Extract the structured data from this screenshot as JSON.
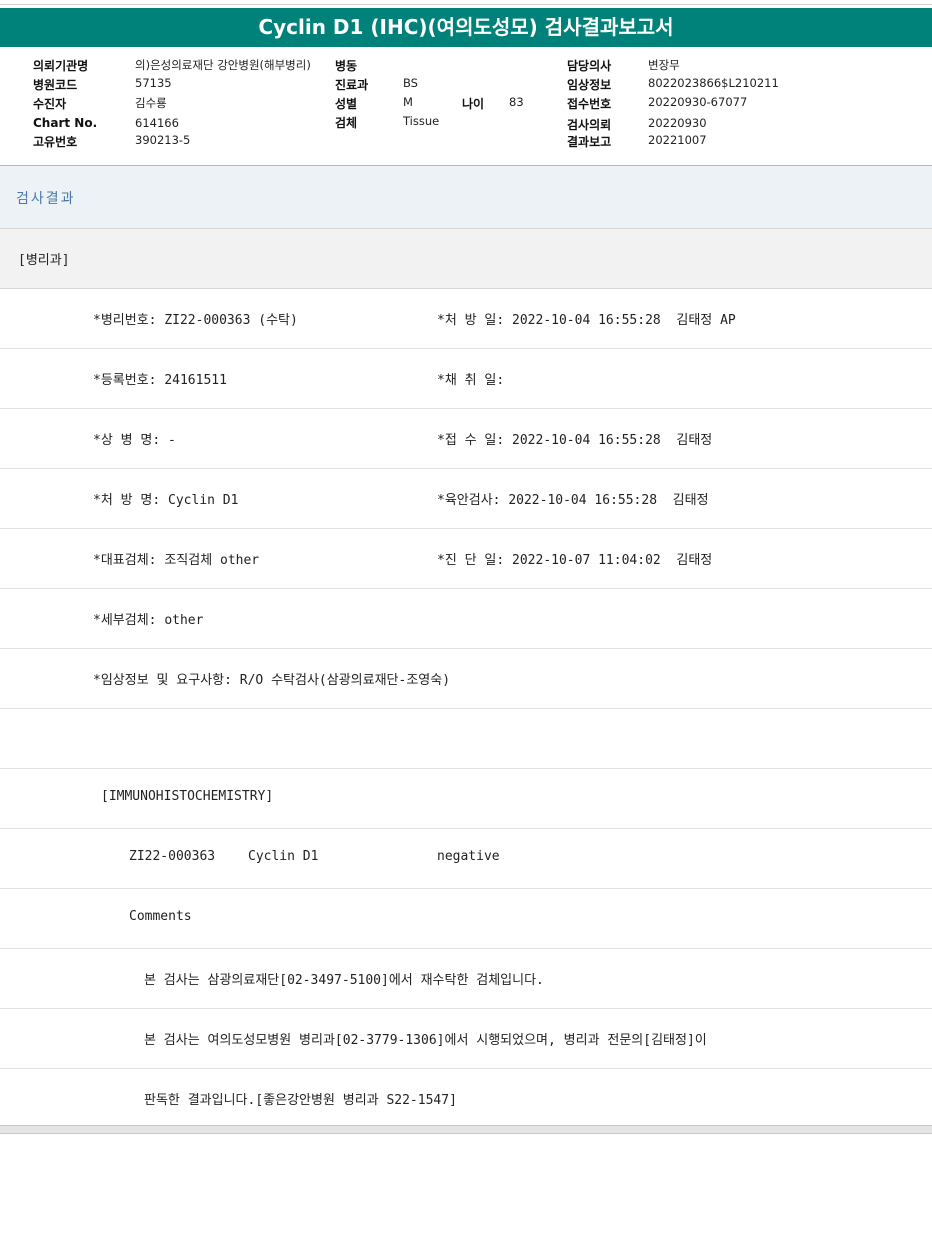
{
  "report": {
    "title": "Cyclin D1 (IHC)(여의도성모) 검사결과보고서"
  },
  "meta": {
    "requesting_org_label": "의뢰기관명",
    "requesting_org": "의)은성의료재단 강안병원(해부병리)",
    "ward_label": "병동",
    "ward": "",
    "hospital_code_label": "병원코드",
    "hospital_code": "57135",
    "patient_label": "수진자",
    "patient": "김수룡",
    "chart_no_label": "Chart No.",
    "chart_no": "614166",
    "unique_no_label": "고유번호",
    "unique_no": "390213-5",
    "department_label": "진료과",
    "department": "BS",
    "sex_label": "성별",
    "sex": "M",
    "age_label": "나이",
    "age": "83",
    "specimen_label": "검체",
    "specimen": "Tissue",
    "doctor_label": "담당의사",
    "doctor": "변장무",
    "clinical_info_label": "임상정보",
    "clinical_info": "8022023866$L210211",
    "receipt_no_label": "접수번호",
    "receipt_no": "20220930-67077",
    "request_date_label": "검사의뢰",
    "request_date": "20220930",
    "report_date_label": "결과보고",
    "report_date": "20221007"
  },
  "results": {
    "section_title": "검사결과",
    "department": "[병리과]",
    "rows": [
      {
        "left": "*병리번호: ZI22-000363 (수탁)",
        "right": "*처 방 일: 2022-10-04 16:55:28  김태정 AP"
      },
      {
        "left": "*등록번호: 24161511",
        "right": "*채 취 일:"
      },
      {
        "left": "*상 병 명: -",
        "right": "*접 수 일: 2022-10-04 16:55:28  김태정"
      },
      {
        "left": "*처 방 명: Cyclin D1",
        "right": "*육안검사: 2022-10-04 16:55:28  김태정"
      },
      {
        "left": "*대표검체: 조직검체 other",
        "right": "*진 단 일: 2022-10-07 11:04:02  김태정"
      },
      {
        "left": "*세부검체: other",
        "right": ""
      },
      {
        "left": "*임상정보 및 요구사항: R/O 수탁검사(삼광의료재단-조영숙)",
        "right": ""
      }
    ],
    "ihc_header": "[IMMUNOHISTOCHEMISTRY]",
    "ihc_row": {
      "case_no": "ZI22-000363",
      "marker": "Cyclin D1",
      "result": "negative"
    },
    "comments_label": "Comments",
    "comment_lines": [
      "본 검사는 삼광의료재단[02-3497-5100]에서 재수탁한 검체입니다.",
      "본 검사는 여의도성모병원 병리과[02-3779-1306]에서 시행되었으며, 병리과 전문의[김태정]이",
      "판독한 결과입니다.[좋은강안병원 병리과 S22-1547]"
    ]
  }
}
